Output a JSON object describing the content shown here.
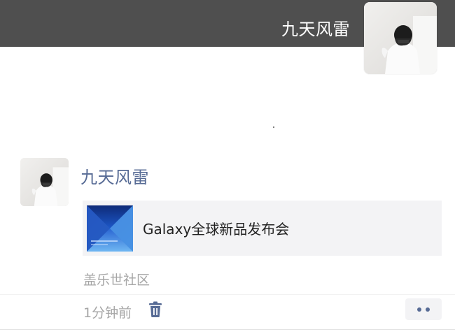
{
  "cover": {
    "username": "九天风雷"
  },
  "post": {
    "author": "九天风雷",
    "link_card": {
      "title": "Galaxy全球新品发布会",
      "thumbnail_icon": "galaxy-launch-thumbnail"
    },
    "source": "盖乐世社区",
    "timestamp": "1分钟前",
    "delete_icon": "trash-icon",
    "more_icon": "more-dots-icon"
  },
  "colors": {
    "cover_bg": "#4f4f4f",
    "author_blue": "#576b95",
    "muted_text": "#a6a6a6",
    "card_bg": "#f3f3f5"
  }
}
